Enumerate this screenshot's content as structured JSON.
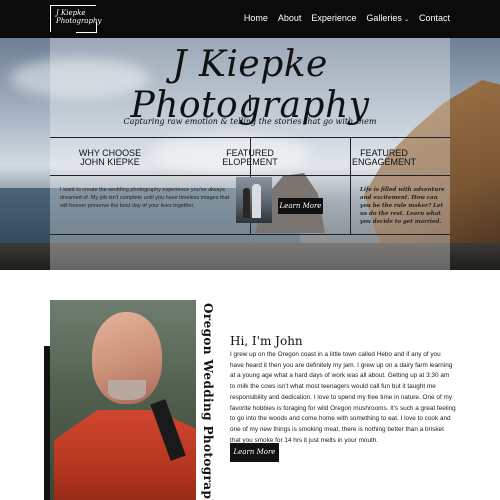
{
  "nav": {
    "logo_text": "J Kiepke Photography",
    "items": [
      {
        "label": "Home"
      },
      {
        "label": "About"
      },
      {
        "label": "Experience"
      },
      {
        "label": "Galleries",
        "chevron": "⌄"
      },
      {
        "label": "Contact"
      }
    ]
  },
  "hero": {
    "title": "J Kiepke Photography",
    "tagline": "Capturing raw emotion & telling the stories that go with them",
    "columns": [
      {
        "heading_line1": "Why choose",
        "heading_line2": "John Kiepke",
        "body": "I want to create the wedding photography experience you've always dreamed of. My job isn't complete until you have timeless images that will forever preserve the best day of your lives together."
      },
      {
        "heading_line1": "Featured",
        "heading_line2": "Elopement",
        "button": "Learn More"
      },
      {
        "heading_line1": "Featured",
        "heading_line2": "Engagement",
        "body": "Life is filled with adventure and excitement. How can you be the rule maker? Let us do the rest. Learn what you decide to get married."
      }
    ]
  },
  "about": {
    "vertical_title": "Oregon Wedding Photographer",
    "greeting": "Hi, I'm John",
    "bio": "I grew up on the Oregon coast in a little town called Hebo and if any of you have heard it then you are definitely my jam. I grew up on a dairy farm learning at a young age what a hard days of work was all about. Getting up at 3:30 am to milk the cows isn't what most teenagers would call fun but it taught me responsibility and dedication. I love to spend my free time in nature. One of my favorite hobbies is foraging for wild Oregon mushrooms. It's such a great feeling to go into the woods and come home with something to eat. I love to cook and one of my new things is smoking meat, there is nothing better than a brisket that you smoke for 14 hrs it just melts in your mouth.",
    "button": "Learn More"
  }
}
